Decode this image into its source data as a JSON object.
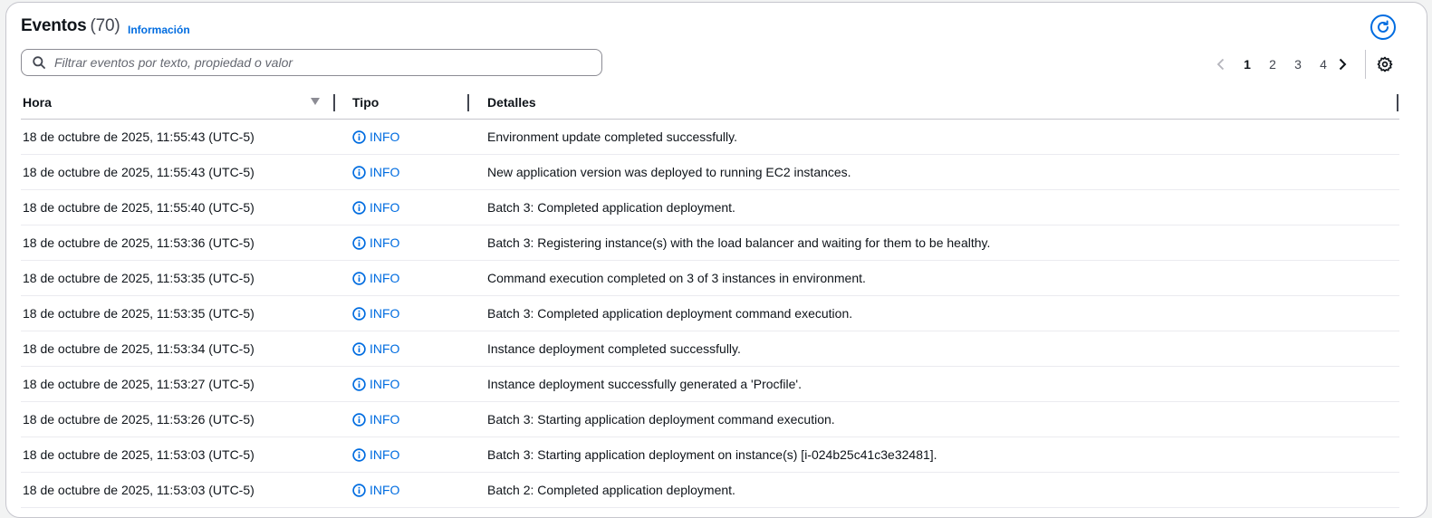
{
  "header": {
    "title": "Eventos",
    "count": "(70)",
    "info_link": "Información"
  },
  "search": {
    "placeholder": "Filtrar eventos por texto, propiedad o valor",
    "value": ""
  },
  "pagination": {
    "pages": [
      "1",
      "2",
      "3",
      "4"
    ],
    "current": "1"
  },
  "columns": {
    "hora": "Hora",
    "tipo": "Tipo",
    "detalles": "Detalles"
  },
  "events": [
    {
      "hora": "18 de octubre de 2025, 11:55:43 (UTC-5)",
      "tipo": "INFO",
      "detalles": "Environment update completed successfully."
    },
    {
      "hora": "18 de octubre de 2025, 11:55:43 (UTC-5)",
      "tipo": "INFO",
      "detalles": "New application version was deployed to running EC2 instances."
    },
    {
      "hora": "18 de octubre de 2025, 11:55:40 (UTC-5)",
      "tipo": "INFO",
      "detalles": "Batch 3: Completed application deployment."
    },
    {
      "hora": "18 de octubre de 2025, 11:53:36 (UTC-5)",
      "tipo": "INFO",
      "detalles": "Batch 3: Registering instance(s) with the load balancer and waiting for them to be healthy."
    },
    {
      "hora": "18 de octubre de 2025, 11:53:35 (UTC-5)",
      "tipo": "INFO",
      "detalles": "Command execution completed on 3 of 3 instances in environment."
    },
    {
      "hora": "18 de octubre de 2025, 11:53:35 (UTC-5)",
      "tipo": "INFO",
      "detalles": "Batch 3: Completed application deployment command execution."
    },
    {
      "hora": "18 de octubre de 2025, 11:53:34 (UTC-5)",
      "tipo": "INFO",
      "detalles": "Instance deployment completed successfully."
    },
    {
      "hora": "18 de octubre de 2025, 11:53:27 (UTC-5)",
      "tipo": "INFO",
      "detalles": "Instance deployment successfully generated a 'Procfile'."
    },
    {
      "hora": "18 de octubre de 2025, 11:53:26 (UTC-5)",
      "tipo": "INFO",
      "detalles": "Batch 3: Starting application deployment command execution."
    },
    {
      "hora": "18 de octubre de 2025, 11:53:03 (UTC-5)",
      "tipo": "INFO",
      "detalles": "Batch 3: Starting application deployment on instance(s) [i-024b25c41c3e32481]."
    },
    {
      "hora": "18 de octubre de 2025, 11:53:03 (UTC-5)",
      "tipo": "INFO",
      "detalles": "Batch 2: Completed application deployment."
    }
  ],
  "icons": {
    "refresh": "refresh-icon",
    "search": "search-icon",
    "prev": "chevron-left-icon",
    "next": "chevron-right-icon",
    "settings": "gear-icon",
    "status": "info-circle-icon",
    "sort": "caret-down-icon"
  },
  "colors": {
    "accent": "#006ce0",
    "text": "#0f141a",
    "border": "#c6c6cd"
  }
}
